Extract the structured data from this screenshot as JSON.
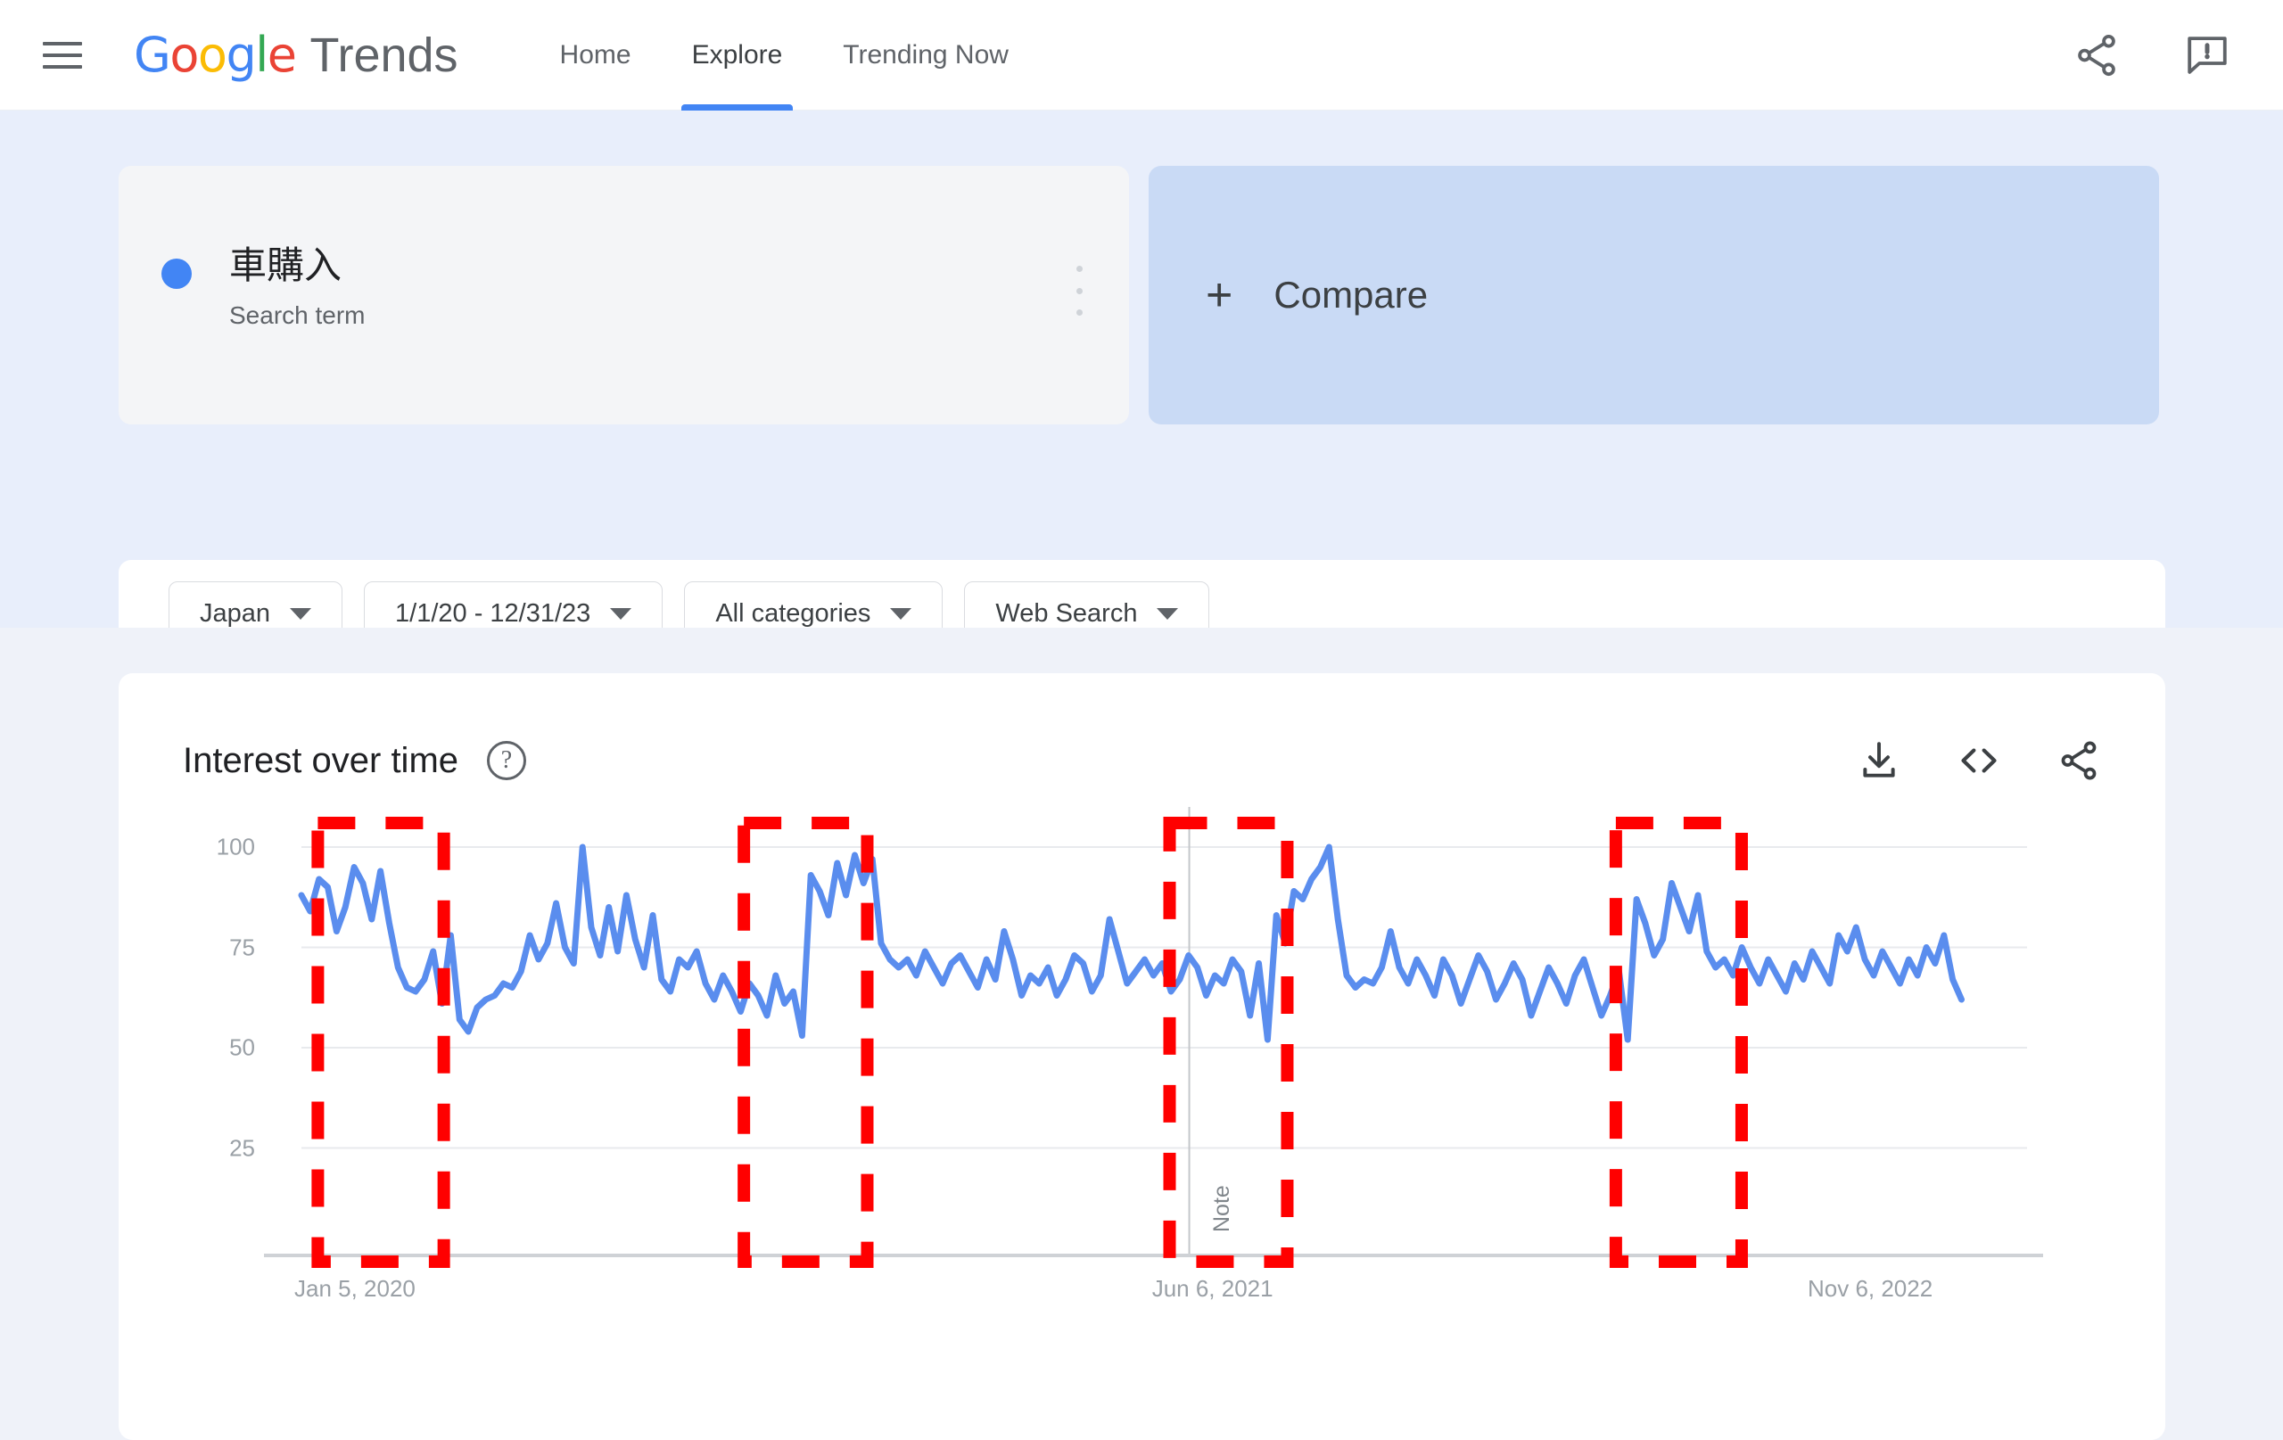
{
  "header": {
    "menu_icon": "hamburger-menu-icon",
    "logo": {
      "google": "Google",
      "product": "Trends"
    },
    "nav": [
      {
        "label": "Home",
        "active": false
      },
      {
        "label": "Explore",
        "active": true
      },
      {
        "label": "Trending Now",
        "active": false
      }
    ],
    "actions": [
      {
        "name": "share-icon",
        "label": "Share"
      },
      {
        "name": "feedback-icon",
        "label": "Send feedback"
      }
    ]
  },
  "query": {
    "term": {
      "name": "車購入",
      "type_label": "Search term",
      "dot_color": "#4285F4",
      "menu_icon": "more-vertical-icon"
    },
    "compare": {
      "plus": "+",
      "label": "Compare"
    }
  },
  "filters": [
    {
      "name": "location-filter",
      "value": "Japan"
    },
    {
      "name": "time-range-filter",
      "value": "1/1/20 - 12/31/23"
    },
    {
      "name": "category-filter",
      "value": "All categories"
    },
    {
      "name": "search-type-filter",
      "value": "Web Search"
    }
  ],
  "chart_card": {
    "title": "Interest over time",
    "help_glyph": "?",
    "tools": [
      {
        "name": "download-icon",
        "label": "Download CSV"
      },
      {
        "name": "embed-code-icon",
        "label": "Embed"
      },
      {
        "name": "share-icon",
        "label": "Share"
      }
    ]
  },
  "chart_data": {
    "type": "line",
    "title": "Interest over time",
    "xlabel": "",
    "ylabel": "",
    "ylim": [
      0,
      110
    ],
    "yticks": [
      25,
      50,
      75,
      100
    ],
    "ytick_labels": [
      "25",
      "50",
      "75",
      "100"
    ],
    "xtick_labels": [
      "Jan 5, 2020",
      "Jun 6, 2021",
      "Nov 6, 2022"
    ],
    "xtick_positions": [
      0,
      0.497,
      0.877
    ],
    "grid": true,
    "legend": false,
    "series_name": "車購入",
    "line_color": "#5A8DEE",
    "annotations": [
      {
        "type": "vertical-line",
        "label": "Note",
        "x_fraction": 0.5145,
        "color": "#c4c7ca"
      }
    ],
    "highlight_boxes": [
      {
        "name": "highlight-box-1",
        "x0": 0.0095,
        "x1": 0.0825,
        "color": "#FF0000"
      },
      {
        "name": "highlight-box-2",
        "x0": 0.2564,
        "x1": 0.3279,
        "color": "#FF0000"
      },
      {
        "name": "highlight-box-3",
        "x0": 0.5031,
        "x1": 0.5713,
        "color": "#FF0000"
      },
      {
        "name": "highlight-box-4",
        "x0": 0.7617,
        "x1": 0.8346,
        "color": "#FF0000"
      }
    ],
    "values": [
      88,
      84,
      92,
      90,
      79,
      85,
      95,
      91,
      82,
      94,
      81,
      70,
      65,
      64,
      67,
      74,
      61,
      78,
      57,
      54,
      60,
      62,
      63,
      66,
      65,
      69,
      78,
      72,
      76,
      86,
      75,
      71,
      100,
      80,
      73,
      85,
      74,
      88,
      77,
      70,
      83,
      67,
      64,
      72,
      70,
      74,
      66,
      62,
      68,
      64,
      59,
      66,
      63,
      58,
      68,
      61,
      64,
      53,
      93,
      89,
      83,
      96,
      88,
      98,
      91,
      97,
      76,
      72,
      70,
      72,
      68,
      74,
      70,
      66,
      71,
      73,
      69,
      65,
      72,
      67,
      79,
      72,
      63,
      68,
      66,
      70,
      63,
      67,
      73,
      71,
      64,
      68,
      82,
      74,
      66,
      69,
      72,
      68,
      71,
      64,
      67,
      73,
      70,
      63,
      68,
      66,
      72,
      69,
      58,
      71,
      52,
      83,
      76,
      89,
      87,
      92,
      95,
      100,
      82,
      68,
      65,
      67,
      66,
      70,
      79,
      70,
      66,
      72,
      68,
      63,
      72,
      68,
      61,
      67,
      73,
      69,
      62,
      66,
      71,
      67,
      58,
      64,
      70,
      66,
      61,
      68,
      72,
      65,
      58,
      63,
      69,
      52,
      87,
      81,
      73,
      77,
      91,
      85,
      79,
      88,
      74,
      70,
      72,
      68,
      75,
      70,
      66,
      72,
      68,
      64,
      71,
      67,
      74,
      70,
      66,
      78,
      74,
      80,
      72,
      68,
      74,
      70,
      66,
      72,
      68,
      75,
      71,
      78,
      67,
      62
    ]
  }
}
